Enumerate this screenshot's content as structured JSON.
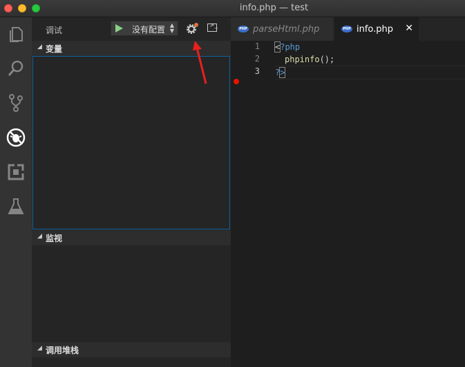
{
  "window": {
    "title": "info.php — test"
  },
  "activity_bar": {
    "items": [
      {
        "name": "explorer-icon"
      },
      {
        "name": "search-icon"
      },
      {
        "name": "source-control-icon"
      },
      {
        "name": "debug-icon"
      },
      {
        "name": "extensions-icon"
      },
      {
        "name": "flask-icon"
      }
    ]
  },
  "debug": {
    "title": "调试",
    "config_label": "没有配置",
    "sections": {
      "variables": "变量",
      "watch": "监视",
      "call_stack": "调用堆栈"
    }
  },
  "editor": {
    "tabs": [
      {
        "label": "parseHtml.php",
        "active": false
      },
      {
        "label": "info.php",
        "active": true
      }
    ],
    "tab_badge": "PHP",
    "close_glyph": "✕",
    "lines": [
      {
        "num": "1",
        "parts": [
          "<",
          "?php"
        ]
      },
      {
        "num": "2",
        "parts": [
          "phpinfo",
          "();"
        ]
      },
      {
        "num": "3",
        "parts": [
          "?",
          ">"
        ]
      }
    ]
  },
  "colors": {
    "accent": "#0e639c",
    "breakpoint": "#e51400",
    "play": "#89d185",
    "arrow": "#e8201d"
  }
}
